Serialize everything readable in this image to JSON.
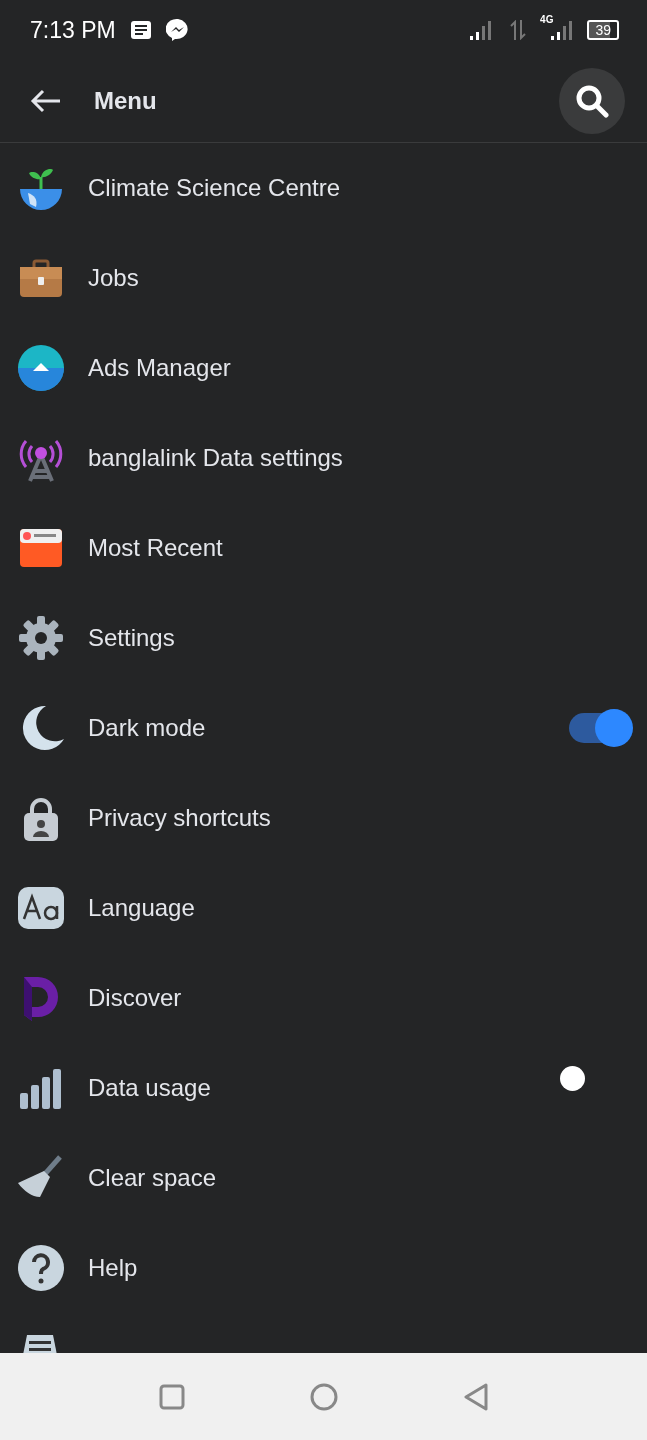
{
  "status_bar": {
    "time": "7:13 PM",
    "network": "4G",
    "battery": "39"
  },
  "header": {
    "title": "Menu"
  },
  "items": [
    {
      "label": "Climate Science Centre",
      "kind": "link"
    },
    {
      "label": "Jobs",
      "kind": "link"
    },
    {
      "label": "Ads Manager",
      "kind": "link"
    },
    {
      "label": "banglalink Data settings",
      "kind": "link"
    },
    {
      "label": "Most Recent",
      "kind": "link"
    },
    {
      "label": "Settings",
      "kind": "link"
    },
    {
      "label": "Dark mode",
      "kind": "toggle",
      "on": true
    },
    {
      "label": "Privacy shortcuts",
      "kind": "link"
    },
    {
      "label": "Language",
      "kind": "link"
    },
    {
      "label": "Discover",
      "kind": "link"
    },
    {
      "label": "Data usage",
      "kind": "link"
    },
    {
      "label": "Clear space",
      "kind": "link"
    },
    {
      "label": "Help",
      "kind": "link"
    }
  ]
}
